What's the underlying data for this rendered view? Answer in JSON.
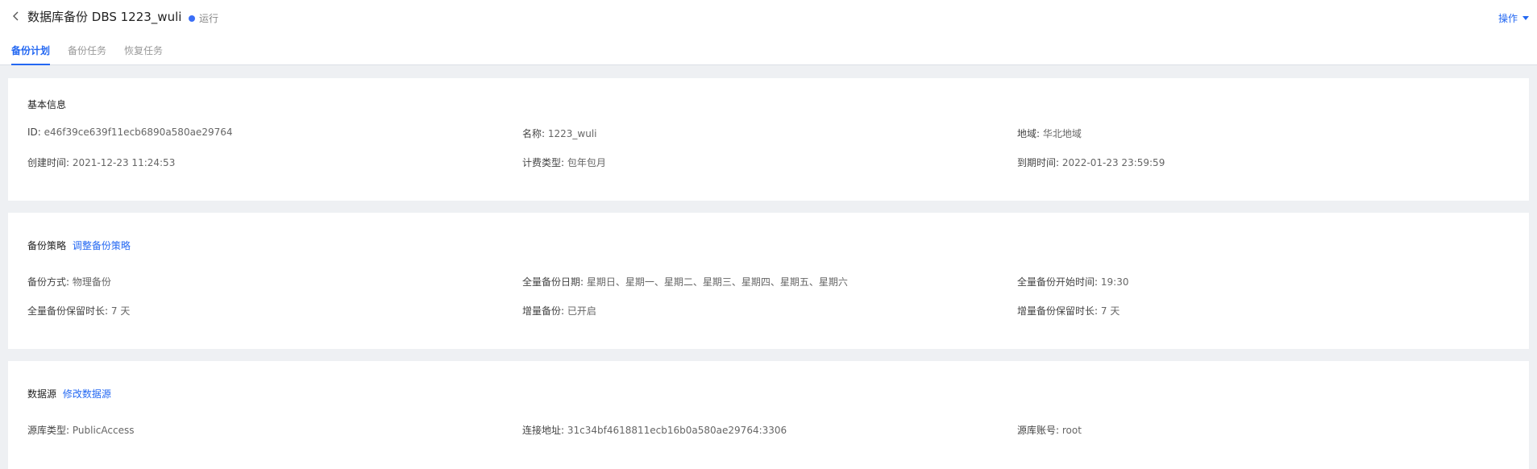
{
  "header": {
    "title": "数据库备份 DBS 1223_wuli",
    "status": "运行",
    "colors": {
      "accent": "#2468f2",
      "status_dot": "#3b6ef6"
    },
    "ops_label": "操作",
    "tabs": [
      {
        "label": "备份计划",
        "active": true
      },
      {
        "label": "备份任务",
        "active": false
      },
      {
        "label": "恢复任务",
        "active": false
      }
    ]
  },
  "basic": {
    "title": "基本信息",
    "id_label": "ID:",
    "id_value": "e46f39ce639f11ecb6890a580ae29764",
    "name_label": "名称:",
    "name_value": "1223_wuli",
    "region_label": "地域:",
    "region_value": "华北地域",
    "created_label": "创建时间:",
    "created_value": "2021-12-23 11:24:53",
    "billing_label": "计费类型:",
    "billing_value": "包年包月",
    "expire_label": "到期时间:",
    "expire_value": "2022-01-23 23:59:59"
  },
  "strategy": {
    "title": "备份策略",
    "link": "调整备份策略",
    "method_label": "备份方式:",
    "method_value": "物理备份",
    "full_date_label": "全量备份日期:",
    "full_date_value": "星期日、星期一、星期二、星期三、星期四、星期五、星期六",
    "full_start_label": "全量备份开始时间:",
    "full_start_value": "19:30",
    "full_retain_label": "全量备份保留时长:",
    "full_retain_value": "7 天",
    "incr_label": "增量备份:",
    "incr_value": "已开启",
    "incr_retain_label": "增量备份保留时长:",
    "incr_retain_value": "7 天"
  },
  "source": {
    "title": "数据源",
    "link": "修改数据源",
    "type_label": "源库类型:",
    "type_value": "PublicAccess",
    "addr_label": "连接地址:",
    "addr_value": "31c34bf4618811ecb16b0a580ae29764:3306",
    "account_label": "源库账号:",
    "account_value": "root"
  }
}
